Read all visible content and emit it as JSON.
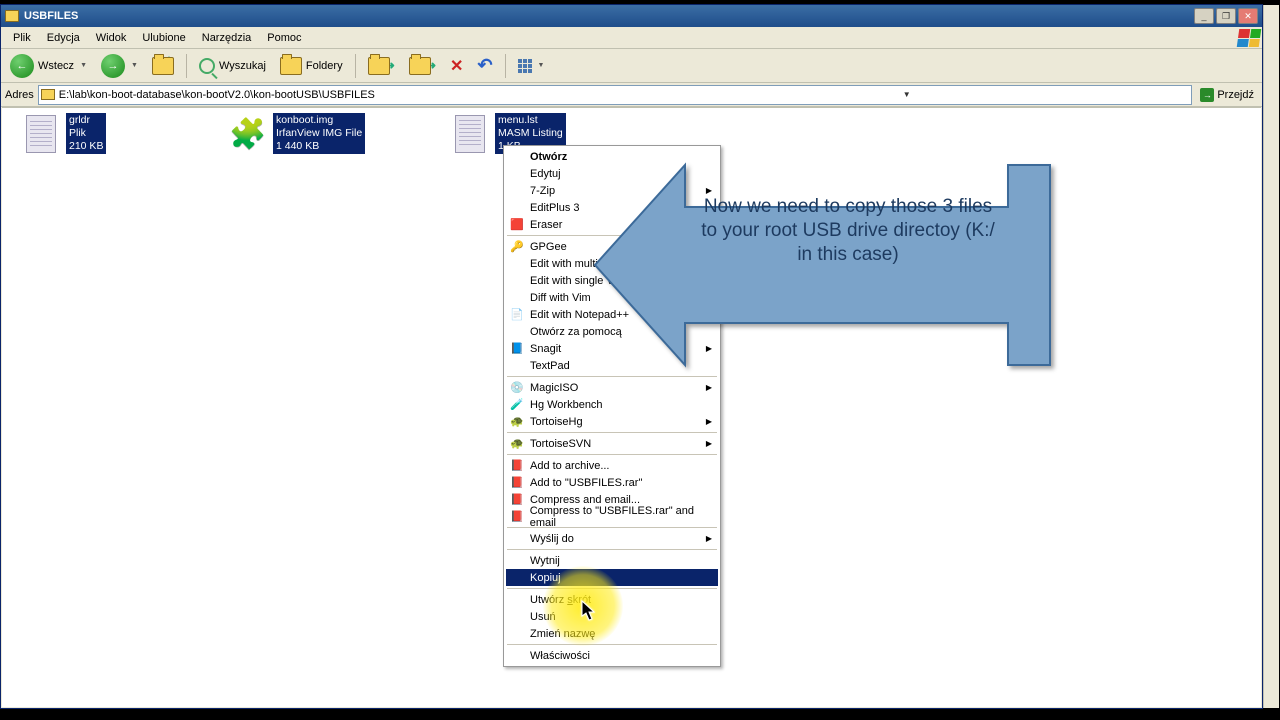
{
  "title": "USBFILES",
  "menus": {
    "plik": "Plik",
    "edycja": "Edycja",
    "widok": "Widok",
    "ulubione": "Ulubione",
    "narzedzia": "Narzędzia",
    "pomoc": "Pomoc"
  },
  "toolbar": {
    "wstecz": "Wstecz",
    "wyszukaj": "Wyszukaj",
    "foldery": "Foldery"
  },
  "address": {
    "label": "Adres",
    "path": "E:\\lab\\kon-boot-database\\kon-bootV2.0\\kon-bootUSB\\USBFILES",
    "go": "Przejdź"
  },
  "files": [
    {
      "name": "grldr",
      "type": "Plik",
      "size": "210 KB"
    },
    {
      "name": "konboot.img",
      "type": "IrfanView IMG File",
      "size": "1 440 KB"
    },
    {
      "name": "menu.lst",
      "type": "MASM Listing",
      "size": "1 KB"
    }
  ],
  "ctx": [
    {
      "label": "Otwórz",
      "bold": true
    },
    {
      "label": "Edytuj"
    },
    {
      "label": "7-Zip",
      "sub": true
    },
    {
      "label": "EditPlus 3"
    },
    {
      "label": "Eraser",
      "icon": "eraser"
    },
    {
      "sep": true
    },
    {
      "label": "GPGee",
      "icon": "key",
      "sub": true
    },
    {
      "label": "Edit with multip..."
    },
    {
      "label": "Edit with single Vim"
    },
    {
      "label": "Diff with Vim"
    },
    {
      "label": "Edit with Notepad++",
      "icon": "npp"
    },
    {
      "label": "Otwórz za pomocą"
    },
    {
      "label": "Snagit",
      "icon": "snag",
      "sub": true
    },
    {
      "label": "TextPad"
    },
    {
      "sep": true
    },
    {
      "label": "MagicISO",
      "icon": "disc",
      "sub": true
    },
    {
      "label": "Hg Workbench",
      "icon": "hg"
    },
    {
      "label": "TortoiseHg",
      "icon": "thg",
      "sub": true
    },
    {
      "sep": true
    },
    {
      "label": "TortoiseSVN",
      "icon": "tsvn",
      "sub": true
    },
    {
      "sep": true
    },
    {
      "label": "Add to archive...",
      "icon": "rar"
    },
    {
      "label": "Add to \"USBFILES.rar\"",
      "icon": "rar"
    },
    {
      "label": "Compress and email...",
      "icon": "rar"
    },
    {
      "label": "Compress to \"USBFILES.rar\" and email",
      "icon": "rar"
    },
    {
      "sep": true
    },
    {
      "label": "Wyślij do",
      "sub": true
    },
    {
      "sep": true
    },
    {
      "label": "Wytnij"
    },
    {
      "label": "Kopiuj",
      "hl": true
    },
    {
      "sep": true
    },
    {
      "label": "Utwórz skrót",
      "u": "s"
    },
    {
      "label": "Usuń"
    },
    {
      "label": "Zmień nazwę"
    },
    {
      "sep": true
    },
    {
      "label": "Właściwości"
    }
  ],
  "callout": "Now we need to copy those 3 files to your root USB drive directoy (K:/ in this case)"
}
